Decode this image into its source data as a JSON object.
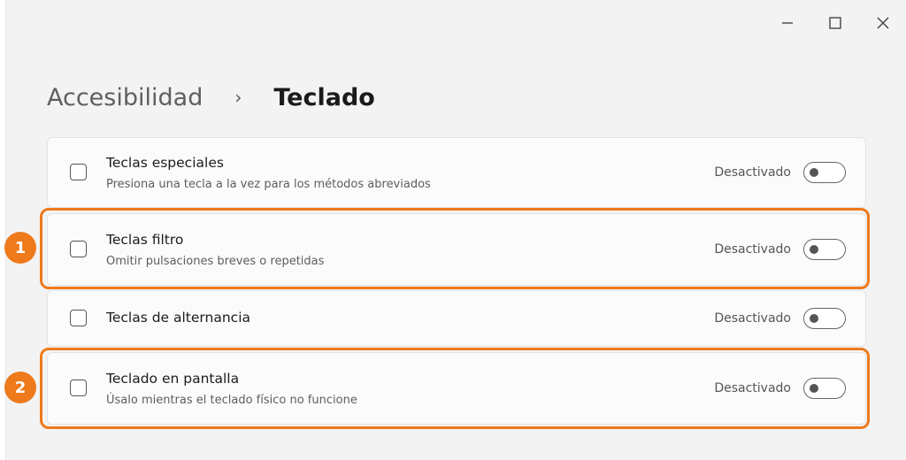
{
  "breadcrumb": {
    "parent": "Accesibilidad",
    "separator": "›",
    "current": "Teclado"
  },
  "window_controls": [
    "minimize-icon",
    "maximize-icon",
    "close-icon"
  ],
  "settings": [
    {
      "title": "Teclas especiales",
      "description": "Presiona una tecla a la vez para los métodos abreviados",
      "state": "Desactivado",
      "on": false
    },
    {
      "title": "Teclas filtro",
      "description": "Omitir pulsaciones breves o repetidas",
      "state": "Desactivado",
      "on": false
    },
    {
      "title": "Teclas de alternancia",
      "state": "Desactivado",
      "on": false
    },
    {
      "title": "Teclado en pantalla",
      "description": "Úsalo mientras el teclado físico no funcione",
      "state": "Desactivado",
      "on": false
    }
  ],
  "annotations": [
    "1",
    "2"
  ],
  "colors": {
    "highlight": "#ee7a1c",
    "background": "#f3f3f3",
    "card": "#fbfbfb"
  }
}
